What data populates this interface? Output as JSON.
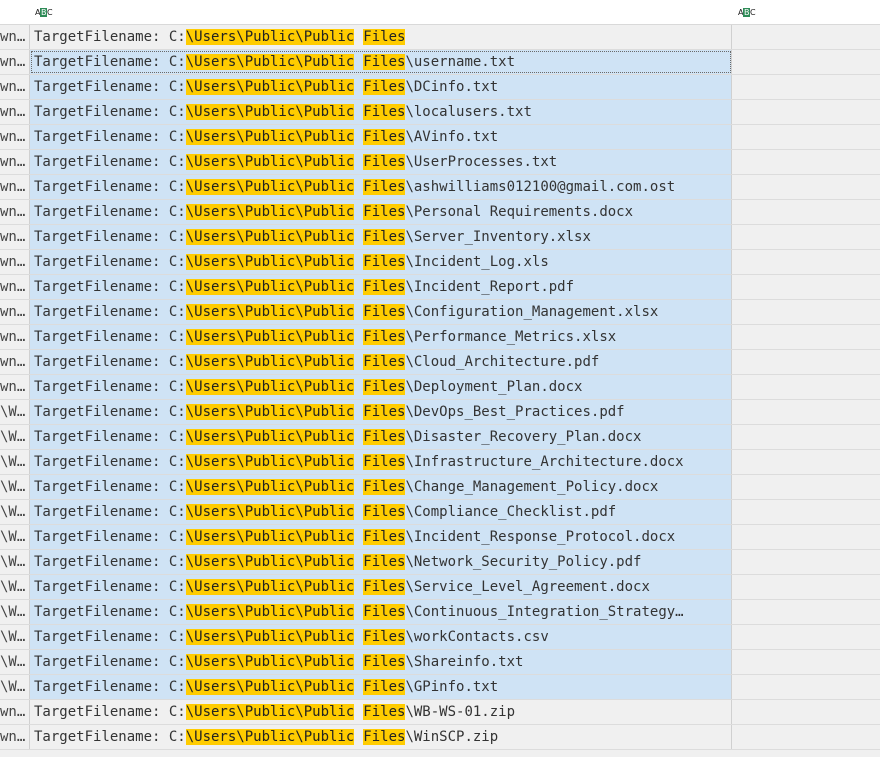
{
  "header": {
    "column_type_icon_left": "ABC",
    "column_type_icon_right": "ABC"
  },
  "row_prefix": "TargetFilename: C:",
  "highlight_path_a": "\\Users\\Public\\Public",
  "highlight_path_b": "Files",
  "rows": [
    {
      "left": "wn…",
      "suffix": "",
      "selected": false
    },
    {
      "left": "wn…",
      "suffix": "\\username.txt",
      "selected": true,
      "focused": true
    },
    {
      "left": "wn…",
      "suffix": "\\DCinfo.txt",
      "selected": true
    },
    {
      "left": "wn…",
      "suffix": "\\localusers.txt",
      "selected": true
    },
    {
      "left": "wn…",
      "suffix": "\\AVinfo.txt",
      "selected": true
    },
    {
      "left": "wn…",
      "suffix": "\\UserProcesses.txt",
      "selected": true
    },
    {
      "left": "wn…",
      "suffix": "\\ashwilliams012100@gmail.com.ost",
      "selected": true
    },
    {
      "left": "wn…",
      "suffix": "\\Personal Requirements.docx",
      "selected": true
    },
    {
      "left": "wn…",
      "suffix": "\\Server_Inventory.xlsx",
      "selected": true
    },
    {
      "left": "wn…",
      "suffix": "\\Incident_Log.xls",
      "selected": true
    },
    {
      "left": "wn…",
      "suffix": "\\Incident_Report.pdf",
      "selected": true
    },
    {
      "left": "wn…",
      "suffix": "\\Configuration_Management.xlsx",
      "selected": true
    },
    {
      "left": "wn…",
      "suffix": "\\Performance_Metrics.xlsx",
      "selected": true
    },
    {
      "left": "wn…",
      "suffix": "\\Cloud_Architecture.pdf",
      "selected": true
    },
    {
      "left": "wn…",
      "suffix": "\\Deployment_Plan.docx",
      "selected": true
    },
    {
      "left": "\\W…",
      "suffix": "\\DevOps_Best_Practices.pdf",
      "selected": true
    },
    {
      "left": "\\W…",
      "suffix": "\\Disaster_Recovery_Plan.docx",
      "selected": true
    },
    {
      "left": "\\W…",
      "suffix": "\\Infrastructure_Architecture.docx",
      "selected": true
    },
    {
      "left": "\\W…",
      "suffix": "\\Change_Management_Policy.docx",
      "selected": true
    },
    {
      "left": "\\W…",
      "suffix": "\\Compliance_Checklist.pdf",
      "selected": true
    },
    {
      "left": "\\W…",
      "suffix": "\\Incident_Response_Protocol.docx",
      "selected": true
    },
    {
      "left": "\\W…",
      "suffix": "\\Network_Security_Policy.pdf",
      "selected": true
    },
    {
      "left": "\\W…",
      "suffix": "\\Service_Level_Agreement.docx",
      "selected": true
    },
    {
      "left": "\\W…",
      "suffix": "\\Continuous_Integration_Strategy…",
      "selected": true
    },
    {
      "left": "\\W…",
      "suffix": "\\workContacts.csv",
      "selected": true
    },
    {
      "left": "\\W…",
      "suffix": "\\Shareinfo.txt",
      "selected": true
    },
    {
      "left": "\\W…",
      "suffix": "\\GPinfo.txt",
      "selected": true
    },
    {
      "left": "wn…",
      "suffix": "\\WB-WS-01.zip",
      "selected": false
    },
    {
      "left": "wn…",
      "suffix": "\\WinSCP.zip",
      "selected": false
    }
  ],
  "colors": {
    "selection": "#cfe3f5",
    "highlight": "#ffcc00",
    "row_bg": "#f0f0f0"
  }
}
